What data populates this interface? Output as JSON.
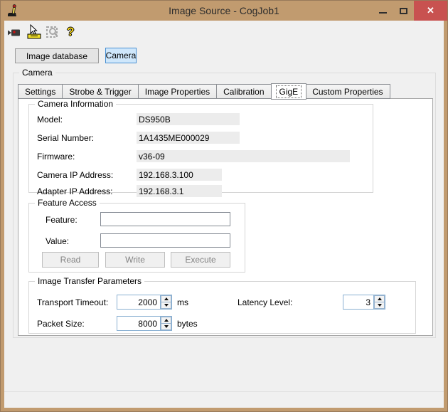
{
  "window": {
    "title": "Image Source - CogJob1"
  },
  "titlebar": {
    "close_glyph": "✕"
  },
  "toolbar": {
    "help_glyph": "?"
  },
  "source_toggle": {
    "image_database": "Image database",
    "camera": "Camera"
  },
  "camera_group_label": "Camera",
  "tabs": {
    "items": [
      "Settings",
      "Strobe & Trigger",
      "Image Properties",
      "Calibration",
      "GigE",
      "Custom Properties"
    ],
    "selected": "GigE"
  },
  "camera_information": {
    "label": "Camera Information",
    "rows": [
      {
        "label": "Model:",
        "value": "DS950B"
      },
      {
        "label": "Serial Number:",
        "value": "1A1435ME000029"
      },
      {
        "label": "Firmware:",
        "value": "v36-09"
      },
      {
        "label": "Camera IP Address:",
        "value": "192.168.3.100"
      },
      {
        "label": "Adapter IP Address:",
        "value": "192.168.3.1"
      }
    ]
  },
  "feature_access": {
    "label": "Feature Access",
    "feature_label": "Feature:",
    "feature_value": "",
    "value_label": "Value:",
    "value_value": "",
    "buttons": {
      "read": "Read",
      "write": "Write",
      "execute": "Execute"
    }
  },
  "image_transfer": {
    "label": "Image Transfer Parameters",
    "transport_timeout": {
      "label": "Transport Timeout:",
      "value": "2000",
      "unit": "ms"
    },
    "packet_size": {
      "label": "Packet Size:",
      "value": "8000",
      "unit": "bytes"
    },
    "latency_level": {
      "label": "Latency Level:",
      "value": "3"
    }
  },
  "colors": {
    "titlebar": "#c19b6f",
    "close_button": "#c85250",
    "selected_toggle_bg": "#cfe7fb",
    "selected_toggle_border": "#4a90d2",
    "client_bg": "#f0f0f0",
    "tab_page_bg": "#ffffff"
  }
}
